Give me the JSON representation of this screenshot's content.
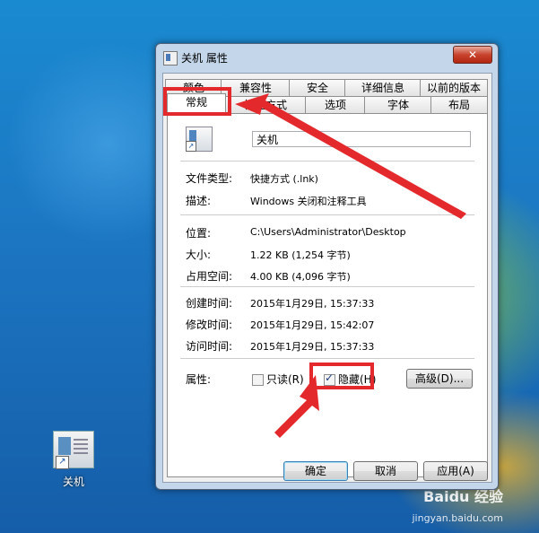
{
  "window": {
    "title": "关机 属性",
    "close_label": "✕"
  },
  "tabs_row1": [
    "颜色",
    "兼容性",
    "安全",
    "详细信息",
    "以前的版本"
  ],
  "tabs_row2": [
    "常规",
    "快捷方式",
    "选项",
    "字体",
    "布局"
  ],
  "general": {
    "name_value": "关机",
    "fields": [
      {
        "label": "文件类型:",
        "value": "快捷方式 (.lnk)"
      },
      {
        "label": "描述:",
        "value": "Windows 关闭和注释工具"
      },
      {
        "label": "位置:",
        "value": "C:\\Users\\Administrator\\Desktop"
      },
      {
        "label": "大小:",
        "value": "1.22 KB (1,254 字节)"
      },
      {
        "label": "占用空间:",
        "value": "4.00 KB (4,096 字节)"
      },
      {
        "label": "创建时间:",
        "value": "2015年1月29日, 15:37:33"
      },
      {
        "label": "修改时间:",
        "value": "2015年1月29日, 15:42:07"
      },
      {
        "label": "访问时间:",
        "value": "2015年1月29日, 15:37:33"
      }
    ],
    "attributes_label": "属性:",
    "readonly_label": "只读(R)",
    "readonly_checked": false,
    "hidden_label": "隐藏(H)",
    "hidden_checked": true,
    "advanced_label": "高级(D)..."
  },
  "buttons": {
    "ok": "确定",
    "cancel": "取消",
    "apply": "应用(A)"
  },
  "desktop": {
    "icon_label": "关机",
    "watermark": "Baidu 经验",
    "watermark_sub": "jingyan.baidu.com"
  },
  "annotation_color": "#e4292d"
}
